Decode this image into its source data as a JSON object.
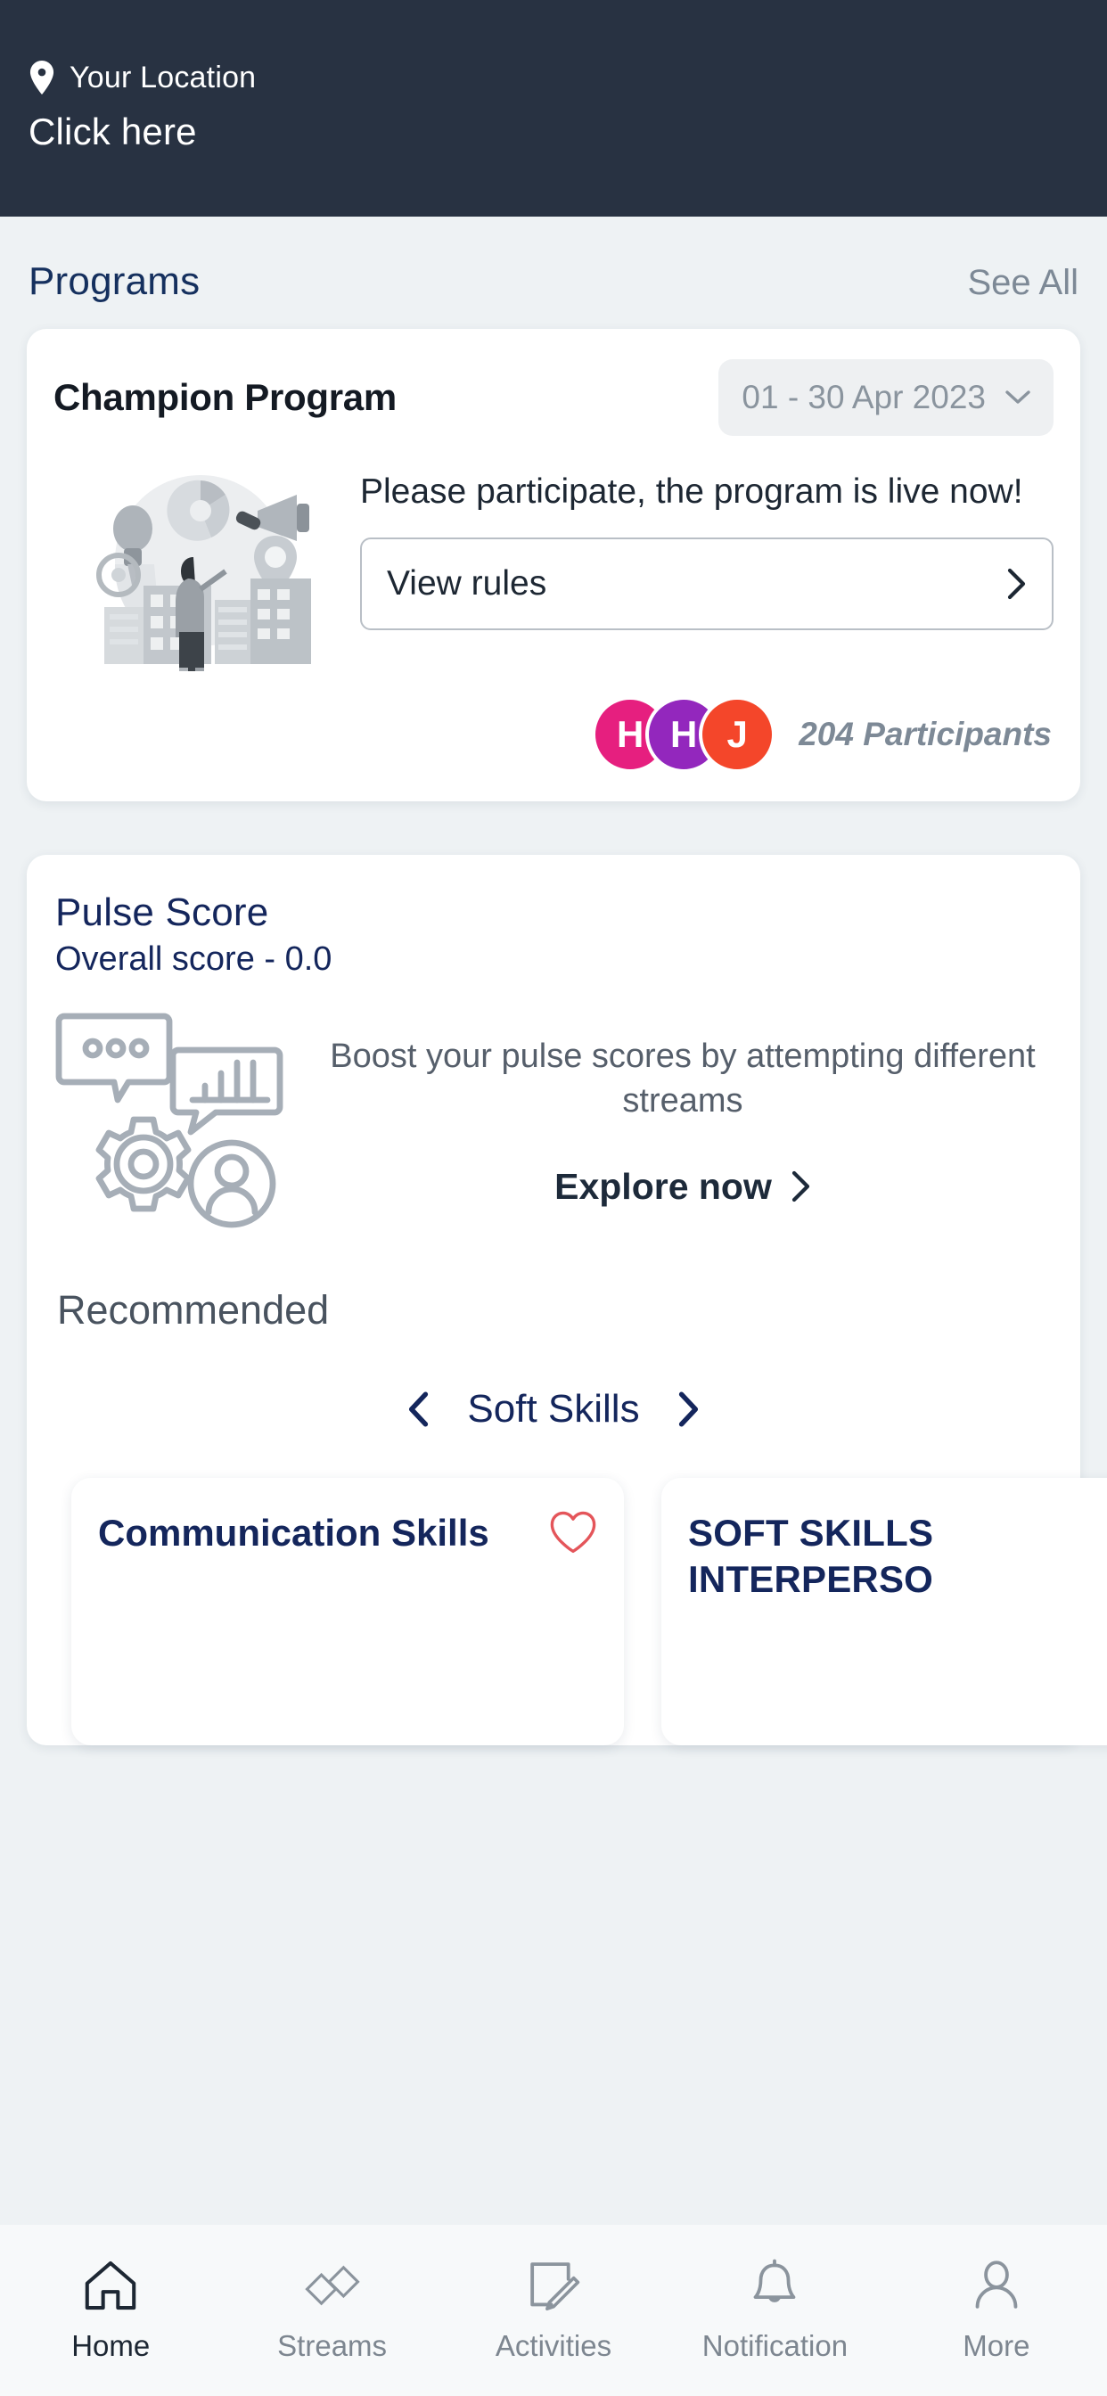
{
  "header": {
    "location_icon": "map-pin-icon",
    "location_label": "Your Location",
    "location_value": "Click here",
    "bg_color": "#283242"
  },
  "programs_section": {
    "title": "Programs",
    "see_all": "See All"
  },
  "program_card": {
    "name": "Champion Program",
    "date_range": "01 - 30 Apr 2023",
    "dropdown_icon": "chevron-down-icon",
    "illustration": "champion-program-illustration",
    "message": "Please participate, the program is live now!",
    "rules_button": "View rules",
    "rules_icon": "chevron-right-icon",
    "participants_text": "204 Participants",
    "avatars": [
      {
        "initial": "H",
        "color": "#e61f7f"
      },
      {
        "initial": "H",
        "color": "#9327bd"
      },
      {
        "initial": "J",
        "color": "#f4462a"
      }
    ]
  },
  "pulse_card": {
    "title": "Pulse Score",
    "overall_label": "Overall score -  0.0",
    "illustration": "pulse-score-illustration",
    "message": "Boost your pulse scores by attempting different streams",
    "explore_label": "Explore now",
    "explore_icon": "chevron-right-icon",
    "recommended_title": "Recommended",
    "carousel": {
      "prev_icon": "chevron-left-icon",
      "label": "Soft Skills",
      "next_icon": "chevron-right-icon"
    },
    "courses": [
      {
        "title": "Communication Skills",
        "favorite_icon": "heart-outline-icon",
        "favorite_color": "#e4555a"
      },
      {
        "title": "SOFT SKILLS INTERPERSO",
        "favorite_icon": "heart-outline-icon",
        "favorite_color": "#e4555a"
      }
    ]
  },
  "bottom_nav": {
    "items": [
      {
        "label": "Home",
        "icon": "home-icon",
        "active": true
      },
      {
        "label": "Streams",
        "icon": "diamonds-icon",
        "active": false
      },
      {
        "label": "Activities",
        "icon": "page-pencil-icon",
        "active": false
      },
      {
        "label": "Notification",
        "icon": "bell-icon",
        "active": false
      },
      {
        "label": "More",
        "icon": "person-icon",
        "active": false
      }
    ]
  }
}
